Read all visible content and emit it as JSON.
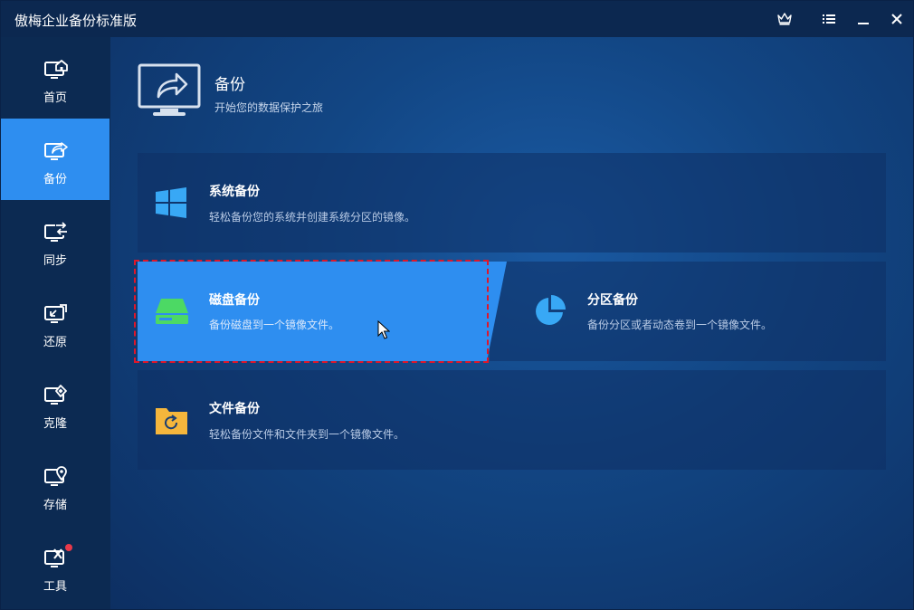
{
  "app": {
    "title": "傲梅企业备份标准版"
  },
  "titlebar": {
    "icons": [
      "crown-icon",
      "menu-icon",
      "minimize-icon",
      "close-icon"
    ]
  },
  "sidebar": {
    "items": [
      {
        "label": "首页",
        "icon": "home-monitor-icon",
        "active": false
      },
      {
        "label": "备份",
        "icon": "backup-monitor-icon",
        "active": true
      },
      {
        "label": "同步",
        "icon": "sync-monitor-icon",
        "active": false
      },
      {
        "label": "还原",
        "icon": "restore-monitor-icon",
        "active": false
      },
      {
        "label": "克隆",
        "icon": "clone-monitor-icon",
        "active": false
      },
      {
        "label": "存储",
        "icon": "storage-monitor-icon",
        "active": false
      },
      {
        "label": "工具",
        "icon": "tools-monitor-icon",
        "active": false
      }
    ]
  },
  "header": {
    "title": "备份",
    "subtitle": "开始您的数据保护之旅"
  },
  "cards": {
    "system": {
      "title": "系统备份",
      "desc": "轻松备份您的系统并创建系统分区的镜像。"
    },
    "disk": {
      "title": "磁盘备份",
      "desc": "备份磁盘到一个镜像文件。"
    },
    "partition": {
      "title": "分区备份",
      "desc": "备份分区或者动态卷到一个镜像文件。"
    },
    "file": {
      "title": "文件备份",
      "desc": "轻松备份文件和文件夹到一个镜像文件。"
    }
  },
  "colors": {
    "accent": "#2e8ef0",
    "selection_outline": "#e0162a",
    "disk_icon": "#4cd964",
    "folder_icon": "#f5b63c",
    "windows_icon": "#38a8f5"
  }
}
